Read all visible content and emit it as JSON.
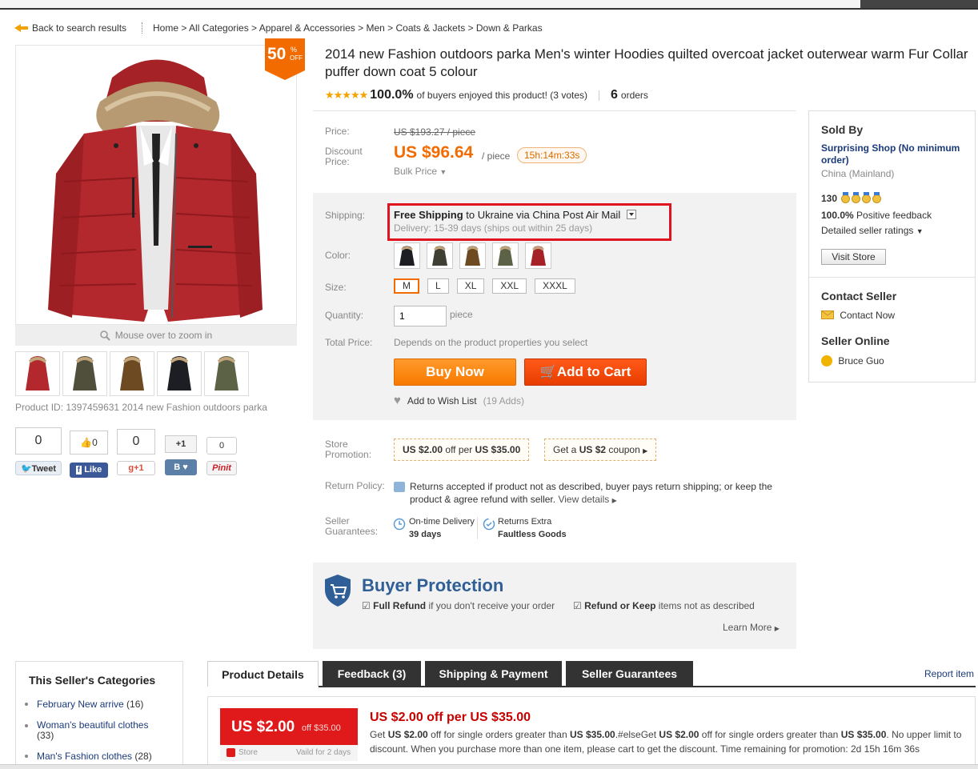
{
  "breadcrumb": {
    "back_label": "Back to search results",
    "path": "Home > All Categories > Apparel & Accessories > Men > Coats & Jackets > Down & Parkas"
  },
  "gallery": {
    "discount_number": "50",
    "discount_percent": "%",
    "discount_off": "OFF",
    "zoom_hint": "Mouse over to zoom in",
    "product_id_label": "Product ID: 1397459631 2014 new Fashion outdoors parka"
  },
  "social": {
    "tweet_count": "0",
    "tweet_label": "Tweet",
    "like_count": "0",
    "like_label": "Like",
    "gplus_count": "0",
    "gplus_label": "g+1",
    "vk_count": "+1",
    "vk_label": "B",
    "pin_count": "0",
    "pin_label": "Pinit"
  },
  "product": {
    "title": "2014 new Fashion outdoors parka Men's winter Hoodies quilted overcoat jacket outerwear warm Fur Collar puffer down coat 5 colour",
    "stars": "★★★★★",
    "rating_pct": "100.0%",
    "rating_text": "of buyers enjoyed this product! (3 votes)",
    "orders_count": "6",
    "orders_label": "orders"
  },
  "pricing": {
    "price_label": "Price:",
    "old_price": "US $193.27 / piece",
    "discount_label_1": "Discount",
    "discount_label_2": "Price:",
    "new_price": "US $96.64",
    "per_piece": "/ piece",
    "timer": "15h:14m:33s",
    "bulk_price": "Bulk Price"
  },
  "shipping": {
    "label": "Shipping:",
    "free": "Free Shipping",
    "to_text": "to Ukraine via China Post Air Mail",
    "delivery": "Delivery: 15-39 days (ships out within 25 days)"
  },
  "options": {
    "color_label": "Color:",
    "colors": [
      "black",
      "army-green",
      "brown",
      "olive",
      "red"
    ],
    "size_label": "Size:",
    "sizes": [
      "M",
      "L",
      "XL",
      "XXL",
      "XXXL"
    ],
    "selected_size": "M",
    "quantity_label": "Quantity:",
    "quantity_value": "1",
    "quantity_unit": "piece",
    "total_label": "Total Price:",
    "total_desc": "Depends on the product properties you select"
  },
  "actions": {
    "buy_now": "Buy Now",
    "add_to_cart": "Add to Cart",
    "wish_list": "Add to Wish List",
    "wish_adds": "(19 Adds)"
  },
  "store_promotion": {
    "label_1": "Store",
    "label_2": "Promotion:",
    "tag1_amount": "US $2.00",
    "tag1_mid": "off per",
    "tag1_min": "US $35.00",
    "tag2_pre": "Get a",
    "tag2_amount": "US $2",
    "tag2_post": "coupon"
  },
  "return_policy": {
    "label": "Return Policy:",
    "text": "Returns accepted if product not as described, buyer pays return shipping; or keep the product & agree refund with seller.",
    "view_details": "View details"
  },
  "guarantees": {
    "label_1": "Seller",
    "label_2": "Guarantees:",
    "g1_title": "On-time Delivery",
    "g1_value": "39 days",
    "g2_title": "Returns Extra",
    "g2_value": "Faultless Goods"
  },
  "buyer_protection": {
    "title": "Buyer Protection",
    "item1_bold": "Full Refund",
    "item1_rest": "if you don't receive your order",
    "item2_bold": "Refund or Keep",
    "item2_rest": "items not as described",
    "learn_more": "Learn More"
  },
  "seller": {
    "sold_by": "Sold By",
    "shop_name": "Surprising Shop (No minimum order)",
    "location": "China (Mainland)",
    "score": "130",
    "feedback_pct": "100.0%",
    "feedback_label": "Positive feedback",
    "detailed_ratings": "Detailed seller ratings",
    "visit_store": "Visit Store",
    "contact_heading": "Contact Seller",
    "contact_now": "Contact Now",
    "online_heading": "Seller Online",
    "online_name": "Bruce Guo"
  },
  "categories": {
    "title": "This Seller's Categories",
    "items": [
      {
        "name": "February New arrive",
        "count": "(16)"
      },
      {
        "name": "Woman's beautiful clothes",
        "count": "(33)"
      },
      {
        "name": "Man's Fashion clothes",
        "count": "(28)"
      }
    ]
  },
  "tabs": {
    "product_details": "Product Details",
    "feedback": "Feedback (3)",
    "shipping_payment": "Shipping & Payment",
    "seller_guarantees": "Seller Guarantees",
    "report_item": "Report item"
  },
  "promo_detail": {
    "coupon_amount": "US $2.00",
    "coupon_min": "off $35.00",
    "coupon_store": "Store",
    "coupon_valid": "Vaild for 2 days",
    "headline": "US $2.00 off per US $35.00",
    "desc_1": "Get",
    "desc_amt1": "US $2.00",
    "desc_2": "off for single orders greater than",
    "desc_min1": "US $35.00",
    "desc_3": ".#elseGet",
    "desc_amt2": "US $2.00",
    "desc_4": "off for single orders greater than",
    "desc_min2": "US $35.00",
    "desc_5": ". No upper limit to discount. When you purchase more than one item, please cart to get the discount. Time remaining for promotion: 2d 15h 16m 36s"
  },
  "colors": {
    "accent_orange": "#f26b00",
    "cart_red": "#e83d00",
    "highlight_red": "#e0141e",
    "link_blue": "#1b3a7a",
    "protection_blue": "#2f5f96"
  }
}
